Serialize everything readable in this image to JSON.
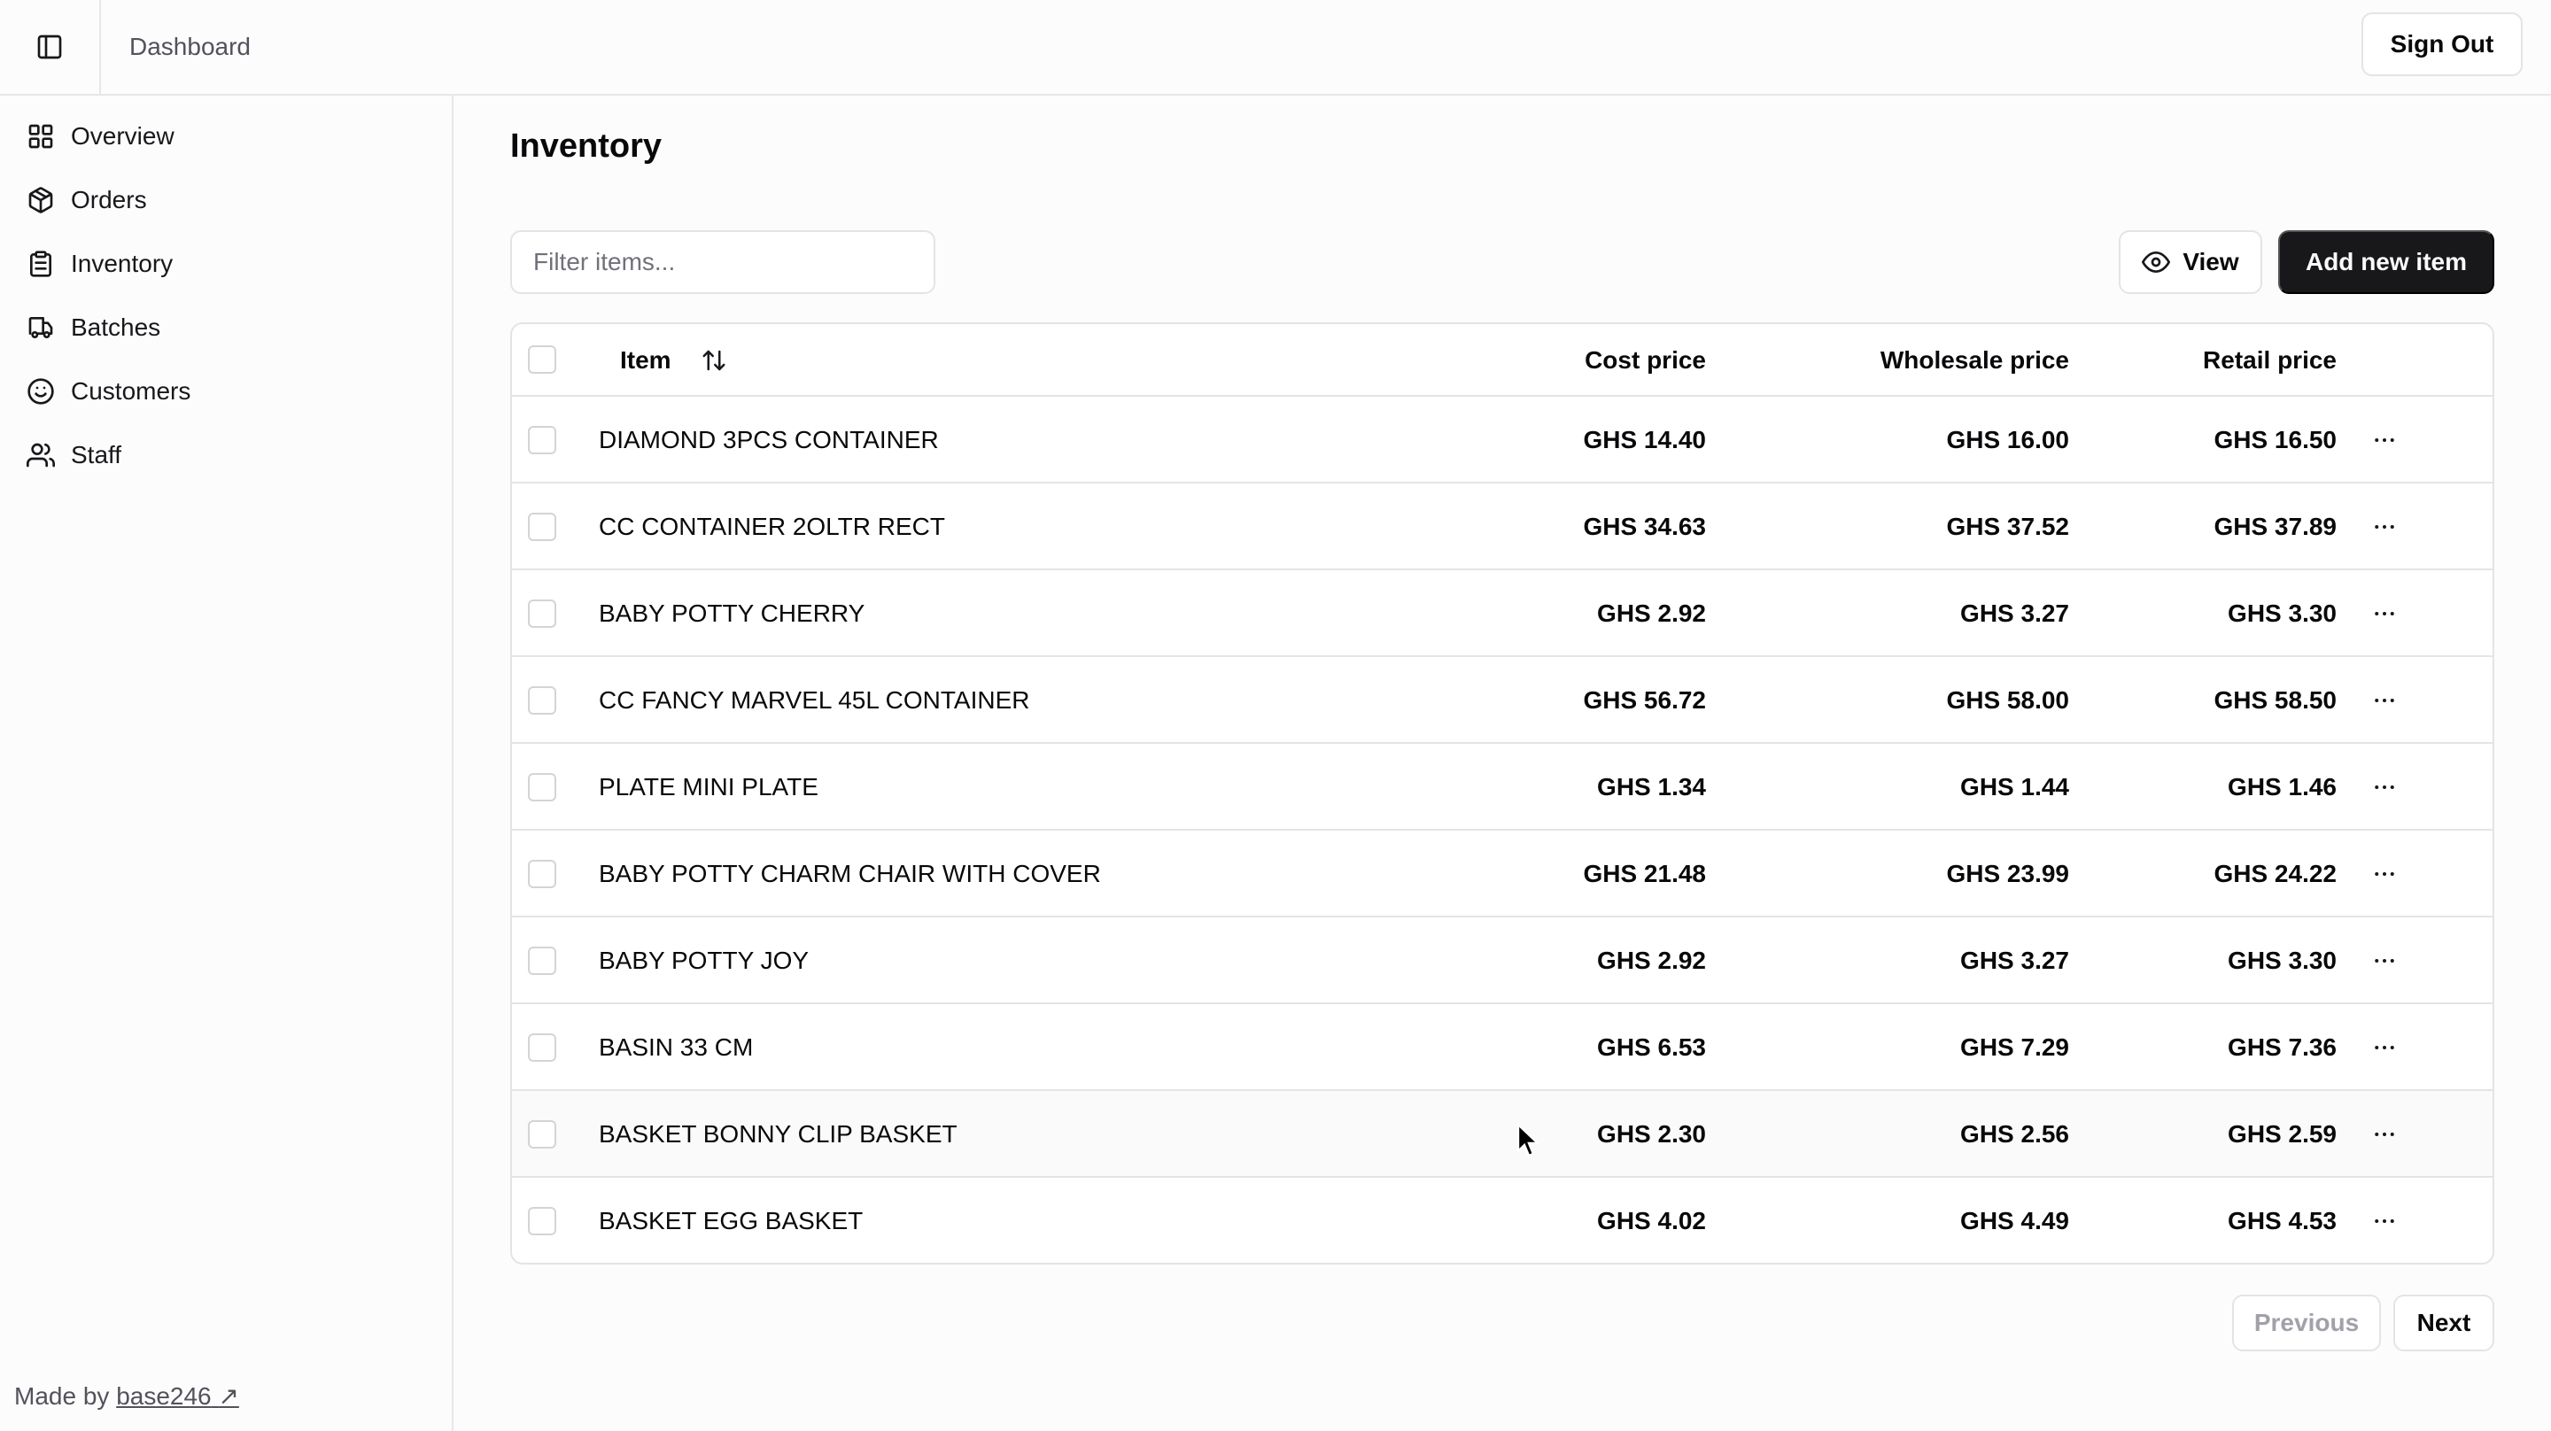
{
  "header": {
    "breadcrumb": "Dashboard",
    "sign_out_label": "Sign Out"
  },
  "sidebar": {
    "items": [
      {
        "label": "Overview",
        "icon": "grid-icon"
      },
      {
        "label": "Orders",
        "icon": "package-icon"
      },
      {
        "label": "Inventory",
        "icon": "clipboard-icon"
      },
      {
        "label": "Batches",
        "icon": "truck-icon"
      },
      {
        "label": "Customers",
        "icon": "smile-icon"
      },
      {
        "label": "Staff",
        "icon": "users-icon"
      }
    ],
    "footer_prefix": "Made by",
    "footer_link": "base246"
  },
  "main": {
    "title": "Inventory",
    "filter_placeholder": "Filter items...",
    "filter_value": "",
    "view_label": "View",
    "add_label": "Add new item"
  },
  "table": {
    "columns": {
      "item": "Item",
      "cost": "Cost price",
      "wholesale": "Wholesale price",
      "retail": "Retail price"
    },
    "rows": [
      {
        "name": "DIAMOND 3PCS CONTAINER",
        "cost": "GHS 14.40",
        "wholesale": "GHS 16.00",
        "retail": "GHS 16.50"
      },
      {
        "name": "CC CONTAINER 2OLTR RECT",
        "cost": "GHS 34.63",
        "wholesale": "GHS 37.52",
        "retail": "GHS 37.89"
      },
      {
        "name": "BABY POTTY CHERRY",
        "cost": "GHS 2.92",
        "wholesale": "GHS 3.27",
        "retail": "GHS 3.30"
      },
      {
        "name": "CC FANCY MARVEL 45L CONTAINER",
        "cost": "GHS 56.72",
        "wholesale": "GHS 58.00",
        "retail": "GHS 58.50"
      },
      {
        "name": "PLATE MINI PLATE",
        "cost": "GHS 1.34",
        "wholesale": "GHS 1.44",
        "retail": "GHS 1.46"
      },
      {
        "name": "BABY POTTY CHARM CHAIR WITH COVER",
        "cost": "GHS 21.48",
        "wholesale": "GHS 23.99",
        "retail": "GHS 24.22"
      },
      {
        "name": "BABY POTTY JOY",
        "cost": "GHS 2.92",
        "wholesale": "GHS 3.27",
        "retail": "GHS 3.30"
      },
      {
        "name": "BASIN 33 CM",
        "cost": "GHS 6.53",
        "wholesale": "GHS 7.29",
        "retail": "GHS 7.36"
      },
      {
        "name": "BASKET BONNY CLIP BASKET",
        "cost": "GHS 2.30",
        "wholesale": "GHS 2.56",
        "retail": "GHS 2.59"
      },
      {
        "name": "BASKET EGG BASKET",
        "cost": "GHS 4.02",
        "wholesale": "GHS 4.49",
        "retail": "GHS 4.53"
      }
    ]
  },
  "pagination": {
    "previous_label": "Previous",
    "next_label": "Next"
  },
  "colors": {
    "primary_button": "#18181b",
    "border": "#e4e4e7",
    "background": "#fcfcfd"
  }
}
